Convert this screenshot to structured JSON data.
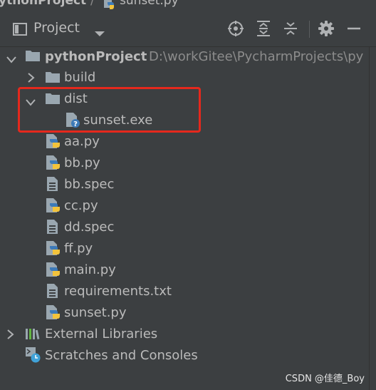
{
  "breadcrumb": {
    "project": "ythonProject",
    "separator": "/",
    "file": "sunset.py"
  },
  "toolwindow": {
    "title": "Project"
  },
  "tree": {
    "root": {
      "name": "pythonProject",
      "path": "D:\\workGitee\\PycharmProjects\\py"
    },
    "items": [
      {
        "label": "build"
      },
      {
        "label": "dist"
      },
      {
        "label": "sunset.exe"
      },
      {
        "label": "aa.py"
      },
      {
        "label": "bb.py"
      },
      {
        "label": "bb.spec"
      },
      {
        "label": "cc.py"
      },
      {
        "label": "dd.spec"
      },
      {
        "label": "ff.py"
      },
      {
        "label": "main.py"
      },
      {
        "label": "requirements.txt"
      },
      {
        "label": "sunset.py"
      },
      {
        "label": "External Libraries"
      },
      {
        "label": "Scratches and Consoles"
      }
    ]
  },
  "watermark": "CSDN @佳德_Boy",
  "colors": {
    "background": "#3c3f41",
    "text": "#bbbbbb",
    "path_text": "#8c8c8c",
    "highlight": "#e5281d",
    "folder": "#9aa7b0",
    "python_blue": "#3d7ab8",
    "python_yellow": "#f3c33b",
    "scratch_blue": "#40a2d8"
  }
}
